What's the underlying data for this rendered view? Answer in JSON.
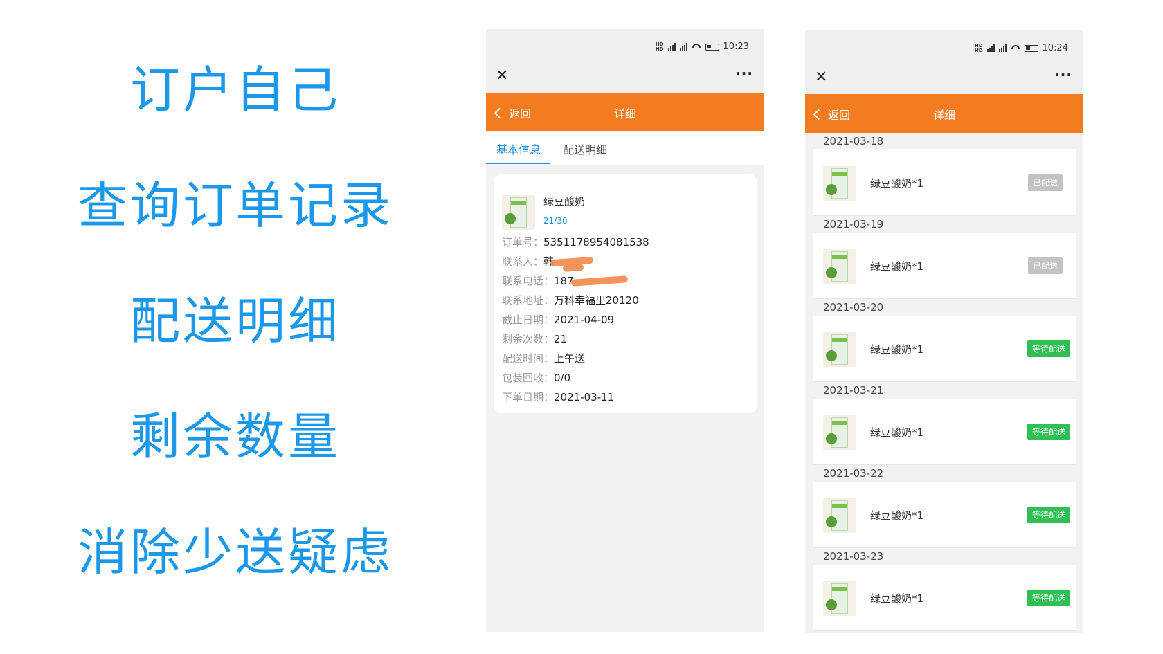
{
  "slogans": [
    "订户自己",
    "查询订单记录",
    "配送明细",
    "剩余数量",
    "消除少送疑虑"
  ],
  "phone1": {
    "status_time": "10:23",
    "nav": {
      "back_label": "返回",
      "title": "详细"
    },
    "tabs": [
      "基本信息",
      "配送明细"
    ],
    "product": {
      "name": "绿豆酸奶",
      "count": "21/30"
    },
    "fields": [
      {
        "label": "订单号：",
        "value": "5351178954081538"
      },
      {
        "label": "联系人：",
        "value": "韩"
      },
      {
        "label": "联系电话：",
        "value": "187"
      },
      {
        "label": "联系地址：",
        "value": "万科幸福里20120"
      },
      {
        "label": "截止日期：",
        "value": "2021-04-09"
      },
      {
        "label": "剩余次数：",
        "value": "21"
      },
      {
        "label": "配送时间：",
        "value": "上午送"
      },
      {
        "label": "包装回收：",
        "value": "0/0"
      },
      {
        "label": "下单日期：",
        "value": "2021-03-11"
      }
    ]
  },
  "phone2": {
    "status_time": "10:24",
    "nav": {
      "back_label": "返回",
      "title": "详细"
    },
    "entries": [
      {
        "date": "2021-03-18",
        "item": "绿豆酸奶*1",
        "status": "已配送"
      },
      {
        "date": "2021-03-19",
        "item": "绿豆酸奶*1",
        "status": "已配送"
      },
      {
        "date": "2021-03-20",
        "item": "绿豆酸奶*1",
        "status": "等待配送"
      },
      {
        "date": "2021-03-21",
        "item": "绿豆酸奶*1",
        "status": "等待配送"
      },
      {
        "date": "2021-03-22",
        "item": "绿豆酸奶*1",
        "status": "等待配送"
      },
      {
        "date": "2021-03-23",
        "item": "绿豆酸奶*1",
        "status": "等待配送"
      }
    ]
  },
  "colors": {
    "accent": "#f47b20",
    "slogan": "#1b98ea",
    "link": "#1b8fe0",
    "delivered": "#c3c3c3",
    "pending": "#2fbf54"
  },
  "icons": [
    "close-icon",
    "more-icon",
    "back-chevron-icon",
    "signal-icon",
    "wifi-icon",
    "battery-icon"
  ]
}
